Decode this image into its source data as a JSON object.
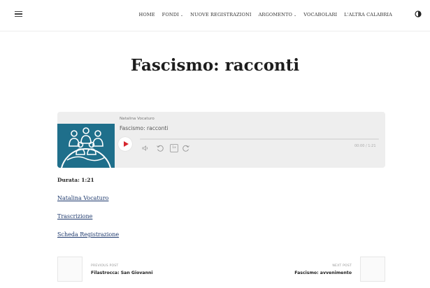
{
  "nav": {
    "items": [
      {
        "label": "HOME",
        "dropdown": false
      },
      {
        "label": "FONDI",
        "dropdown": true
      },
      {
        "label": "NUOVE REGISTRAZIONI",
        "dropdown": false
      },
      {
        "label": "ARGOMENTO",
        "dropdown": true
      },
      {
        "label": "VOCABOLARI",
        "dropdown": false
      },
      {
        "label": "L'ALTRA CALABRIA",
        "dropdown": false
      }
    ]
  },
  "page": {
    "title": "Fascismo: racconti"
  },
  "player": {
    "author": "Natalina Vocaturo",
    "track": "Fascismo: racconti",
    "time": "00:00 / 1:21",
    "speed": "1x",
    "accent": "#d6262e"
  },
  "meta": {
    "duration_label": "Durata:",
    "duration_value": "1:21"
  },
  "links": {
    "author": "Natalina Vocaturo",
    "transcript": "Trascrizione",
    "record": "Scheda Registrazione"
  },
  "postnav": {
    "prev_kicker": "PREVIOUS POST",
    "prev_title": "Filastrocca: San Giovanni",
    "next_kicker": "NEXT POST",
    "next_title": "Fascismo: avvenimento"
  },
  "icons": {
    "menu": "hamburger-icon",
    "contrast": "contrast-icon",
    "play": "play-icon",
    "volume": "volume-icon",
    "rewind": "rewind-icon",
    "forward": "forward-icon"
  }
}
